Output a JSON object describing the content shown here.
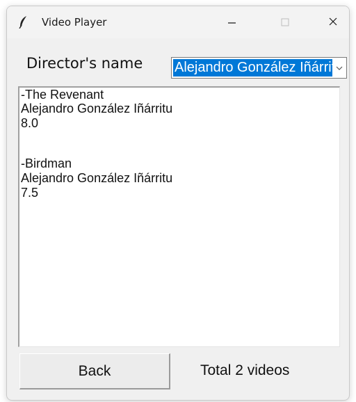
{
  "window": {
    "title": "Video Player",
    "icon": "feather-icon"
  },
  "controls": {
    "minimize_icon": "minimize-icon",
    "maximize_icon": "maximize-icon",
    "close_icon": "close-icon"
  },
  "filter": {
    "label": "Director's name",
    "selected": "Alejandro González Iñárritu"
  },
  "results": {
    "lines": [
      "-The Revenant",
      "Alejandro González Iñárritu",
      "8.0",
      "",
      "-Birdman",
      "Alejandro González Iñárritu",
      "7.5"
    ]
  },
  "footer": {
    "back_label": "Back",
    "total_label": "Total 2 videos"
  },
  "colors": {
    "selection": "#0078d7",
    "window_bg": "#f0f0f0"
  }
}
